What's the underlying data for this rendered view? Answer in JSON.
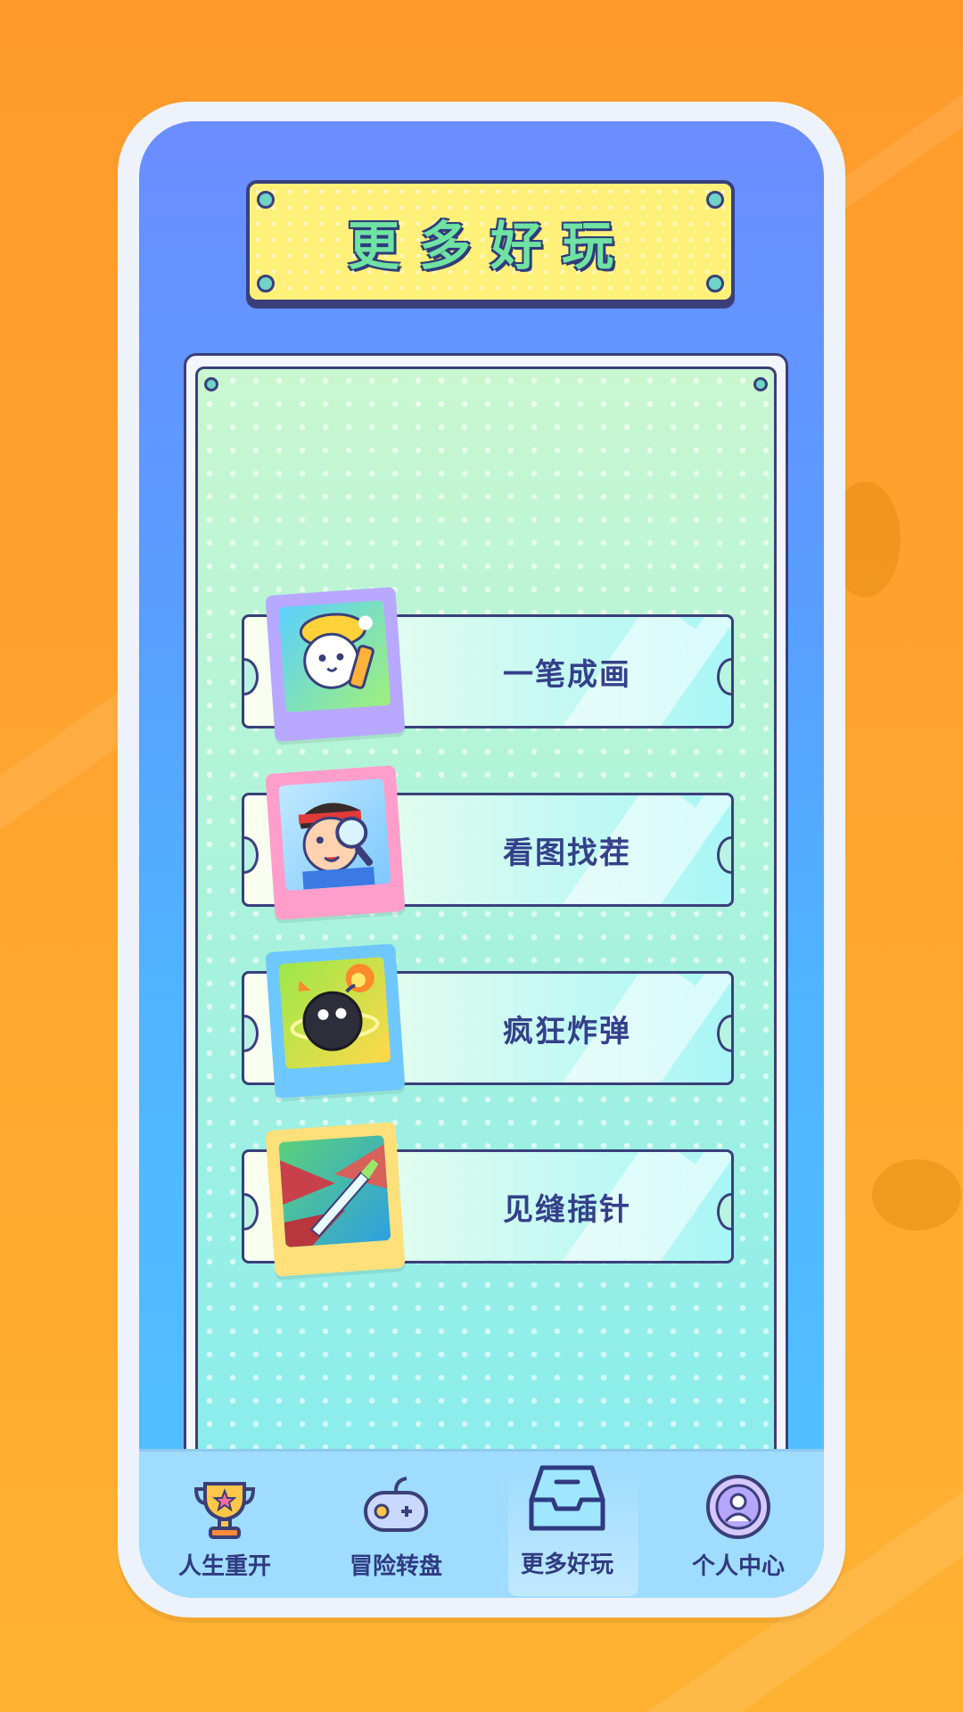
{
  "page": {
    "title": "更多好玩"
  },
  "games": [
    {
      "label": "一笔成画",
      "icon": "cat-builder-icon",
      "frame_color": "#b8a8ff"
    },
    {
      "label": "看图找茬",
      "icon": "magnifier-boy-icon",
      "frame_color": "#ff9ecb"
    },
    {
      "label": "疯狂炸弹",
      "icon": "bomb-icon",
      "frame_color": "#6ec8ff"
    },
    {
      "label": "见缝插针",
      "icon": "knife-slice-icon",
      "frame_color": "#ffe07a"
    }
  ],
  "tabbar": {
    "items": [
      {
        "label": "人生重开",
        "icon": "trophy-icon"
      },
      {
        "label": "冒险转盘",
        "icon": "gamepad-icon"
      },
      {
        "label": "更多好玩",
        "icon": "inbox-tray-icon",
        "active": true
      },
      {
        "label": "个人中心",
        "icon": "user-profile-icon"
      }
    ]
  },
  "colors": {
    "background": "#ffa42e",
    "screen_gradient_top": "#6b8dff",
    "screen_gradient_bottom": "#52c2ff",
    "plaque": "#fff07a",
    "title_text": "#6fe3a2",
    "outline": "#3a3f7a",
    "label_text": "#34408a"
  }
}
